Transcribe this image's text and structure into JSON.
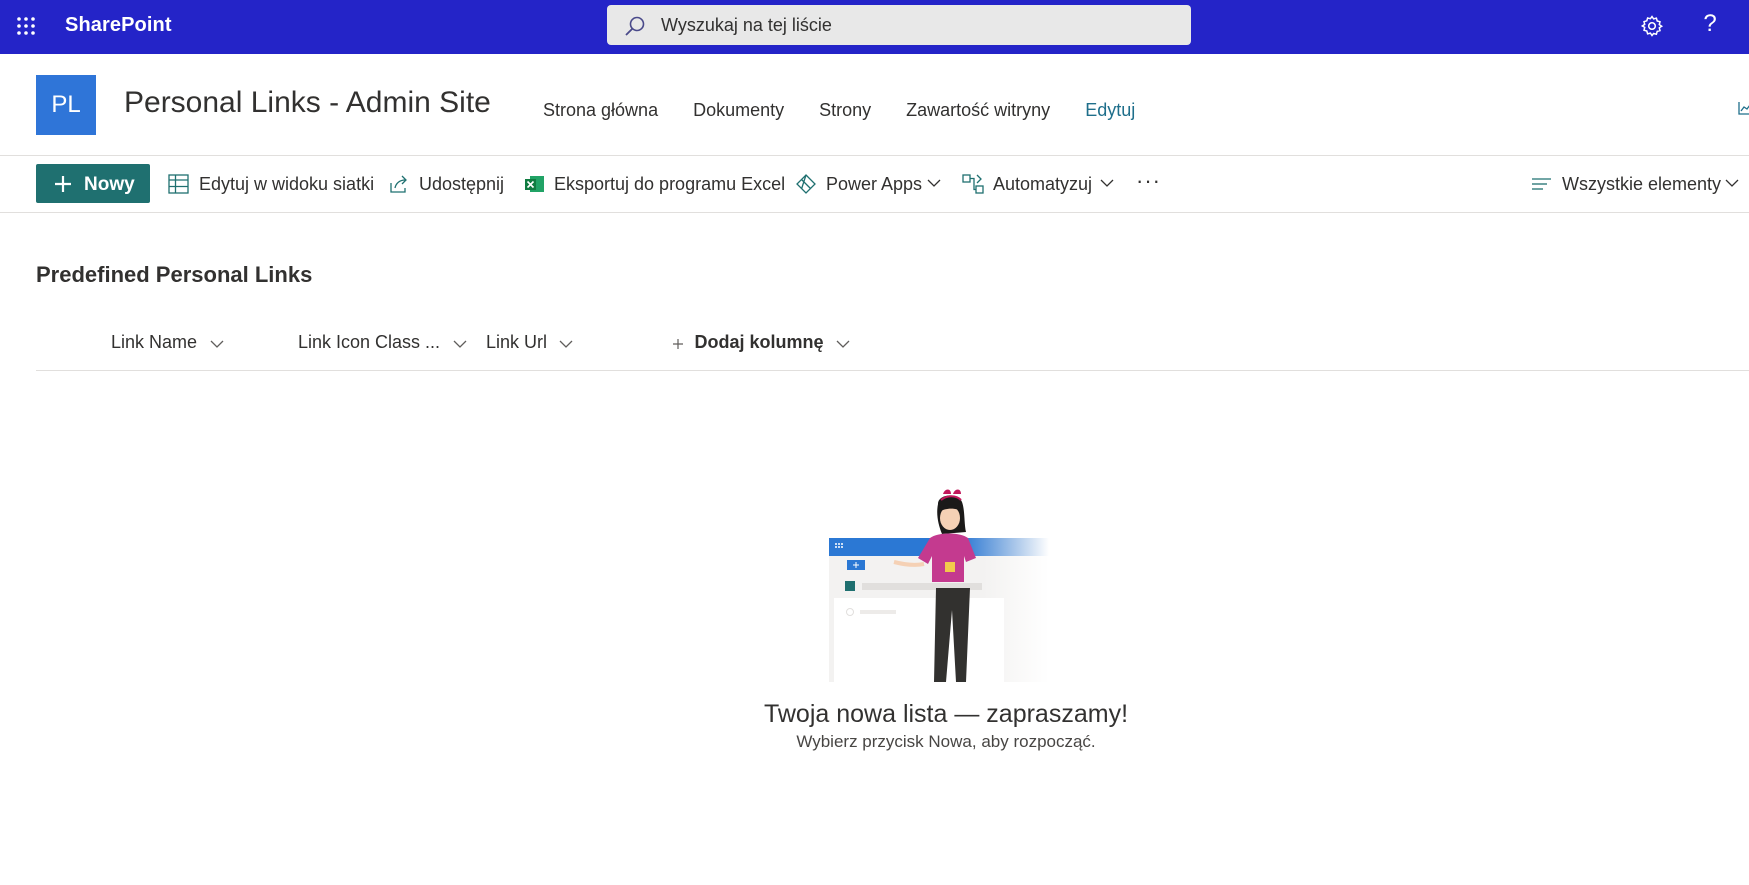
{
  "suitebar": {
    "brand": "SharePoint",
    "search_placeholder": "Wyszukaj na tej liście",
    "waffle_icon": "app-launcher-icon",
    "settings_icon": "gear-icon",
    "help_label": "?"
  },
  "site": {
    "logo_initials": "PL",
    "title": "Personal Links - Admin Site",
    "nav": [
      "Strona główna",
      "Dokumenty",
      "Strony",
      "Zawartość witryny",
      "Edytuj"
    ]
  },
  "commandbar": {
    "new_label": "Nowy",
    "grid_edit_label": "Edytuj w widoku siatki",
    "share_label": "Udostępnij",
    "export_label": "Eksportuj do programu Excel",
    "powerapps_label": "Power Apps",
    "automate_label": "Automatyzuj",
    "more_label": "···",
    "view_label": "Wszystkie elementy"
  },
  "list": {
    "title": "Predefined Personal Links",
    "columns": [
      "Link Name",
      "Link Icon Class ...",
      "Link Url"
    ],
    "add_column_label": "Dodaj kolumnę"
  },
  "empty_state": {
    "title": "Twoja nowa lista — zapraszamy!",
    "subtitle": "Wybierz przycisk Nowa, aby rozpocząć."
  },
  "colors": {
    "suitebar_bg": "#2424c8",
    "accent_teal": "#1f7070",
    "site_logo_bg": "#2f75d8",
    "nav_active": "#1f6f8b"
  }
}
